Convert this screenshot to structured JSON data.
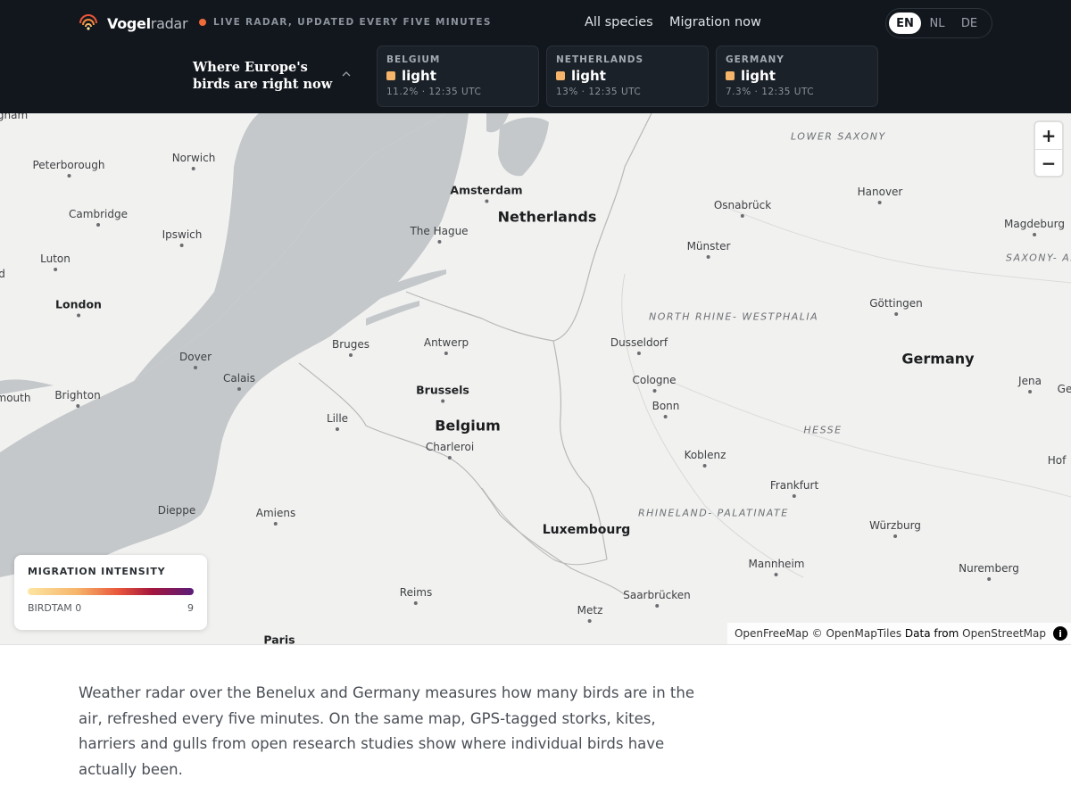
{
  "brand": {
    "name_bold": "Vogel",
    "name_light": "radar"
  },
  "header": {
    "live_status": "LIVE RADAR, UPDATED EVERY FIVE MINUTES",
    "nav": [
      {
        "label": "All species"
      },
      {
        "label": "Migration now"
      }
    ],
    "languages": [
      {
        "code": "EN",
        "active": true
      },
      {
        "code": "NL",
        "active": false
      },
      {
        "code": "DE",
        "active": false
      }
    ],
    "tagline": "Where Europe's birds are right now"
  },
  "countries": [
    {
      "name": "BELGIUM",
      "level": "light",
      "meta": "11.2% · 12:35 UTC",
      "color": "#f6b46a"
    },
    {
      "name": "NETHERLANDS",
      "level": "light",
      "meta": "13% · 12:35 UTC",
      "color": "#f6b46a"
    },
    {
      "name": "GERMANY",
      "level": "light",
      "meta": "7.3% · 12:35 UTC",
      "color": "#f6b46a"
    }
  ],
  "map": {
    "labels": {
      "gham": "gham",
      "peterborough": "Peterborough",
      "norwich": "Norwich",
      "cambridge": "Cambridge",
      "ipswich": "Ipswich",
      "luton": "Luton",
      "london": "London",
      "dover": "Dover",
      "brighton": "Brighton",
      "mouth": "mouth",
      "calais": "Calais",
      "dieppe": "Dieppe",
      "amiens": "Amiens",
      "lille": "Lille",
      "bruges": "Bruges",
      "antwerp": "Antwerp",
      "brussels": "Brussels",
      "belgium": "Belgium",
      "charleroi": "Charleroi",
      "amsterdam": "Amsterdam",
      "netherlands": "Netherlands",
      "the_hague": "The Hague",
      "lower_saxony": "LOWER SAXONY",
      "osnabruck": "Osnabrück",
      "hanover": "Hanover",
      "magdeburg": "Magdeburg",
      "saxony_anhalt": "SAXONY- ANHALT",
      "munster": "Münster",
      "nrw": "NORTH RHINE- WESTPHALIA",
      "gottingen": "Göttingen",
      "dusseldorf": "Dusseldorf",
      "germany": "Germany",
      "cologne": "Cologne",
      "bonn": "Bonn",
      "jena": "Jena",
      "ge": "Ge",
      "hesse": "HESSE",
      "koblenz": "Koblenz",
      "hof": "Hof",
      "frankfurt": "Frankfurt",
      "rlp": "RHINELAND- PALATINATE",
      "luxembourg": "Luxembourg",
      "wurzburg": "Würzburg",
      "mannheim": "Mannheim",
      "nuremberg": "Nuremberg",
      "saarbrucken": "Saarbrücken",
      "reims": "Reims",
      "metz": "Metz",
      "paris": "Paris",
      "d": "d"
    },
    "zoom_in": "+",
    "zoom_out": "−",
    "attribution": {
      "a": "OpenFreeMap",
      "b": "© OpenMapTiles",
      "c": "Data from",
      "d": "OpenStreetMap",
      "info": "i"
    }
  },
  "legend": {
    "title": "MIGRATION INTENSITY",
    "min_label": "BIRDTAM 0",
    "max_label": "9"
  },
  "intro": "Weather radar over the Benelux and Germany measures how many birds are in the air, refreshed every five minutes. On the same map, GPS-tagged storks, kites, harriers and gulls from open research studies show where individual birds have actually been."
}
